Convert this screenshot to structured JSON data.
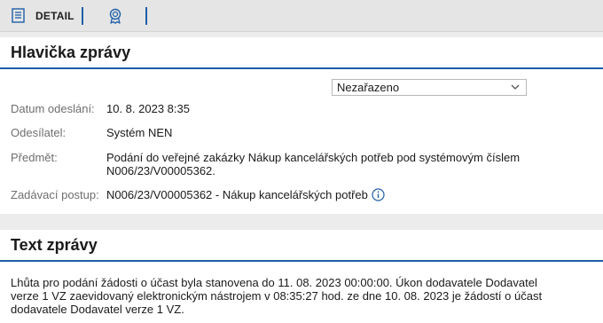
{
  "toolbar": {
    "detail_label": "DETAIL",
    "detail_icon": "document-list-icon",
    "certificate_icon": "certificate-icon"
  },
  "header_section": {
    "title": "Hlavička zprávy",
    "category_select": {
      "value": "Nezařazeno"
    },
    "fields": {
      "sent_date": {
        "label": "Datum odeslání:",
        "value": "10. 8. 2023 8:35"
      },
      "sender": {
        "label": "Odesílatel:",
        "value": "Systém NEN"
      },
      "subject": {
        "label": "Předmět:",
        "value": "Podání do veřejné zakázky Nákup kancelářských potřeb pod systémovým číslem N006/23/V00005362."
      },
      "procedure": {
        "label": "Zadávací postup:",
        "value": "N006/23/V00005362 - Nákup kancelářských potřeb"
      }
    }
  },
  "text_section": {
    "title": "Text zprávy",
    "body": "Lhůta pro podání žádosti o účast byla stanovena do 11. 08. 2023 00:00:00. Úkon dodavatele Dodavatel verze 1 VZ zaevidovaný elektronickým nástrojem v 08:35:27 hod. ze dne 10. 08. 2023 je žádostí o účast dodavatele Dodavatel verze 1 VZ."
  },
  "colors": {
    "accent": "#1e5fa8",
    "toolbar_bg": "#e5e5e5",
    "label_text": "#6e6e6e"
  }
}
